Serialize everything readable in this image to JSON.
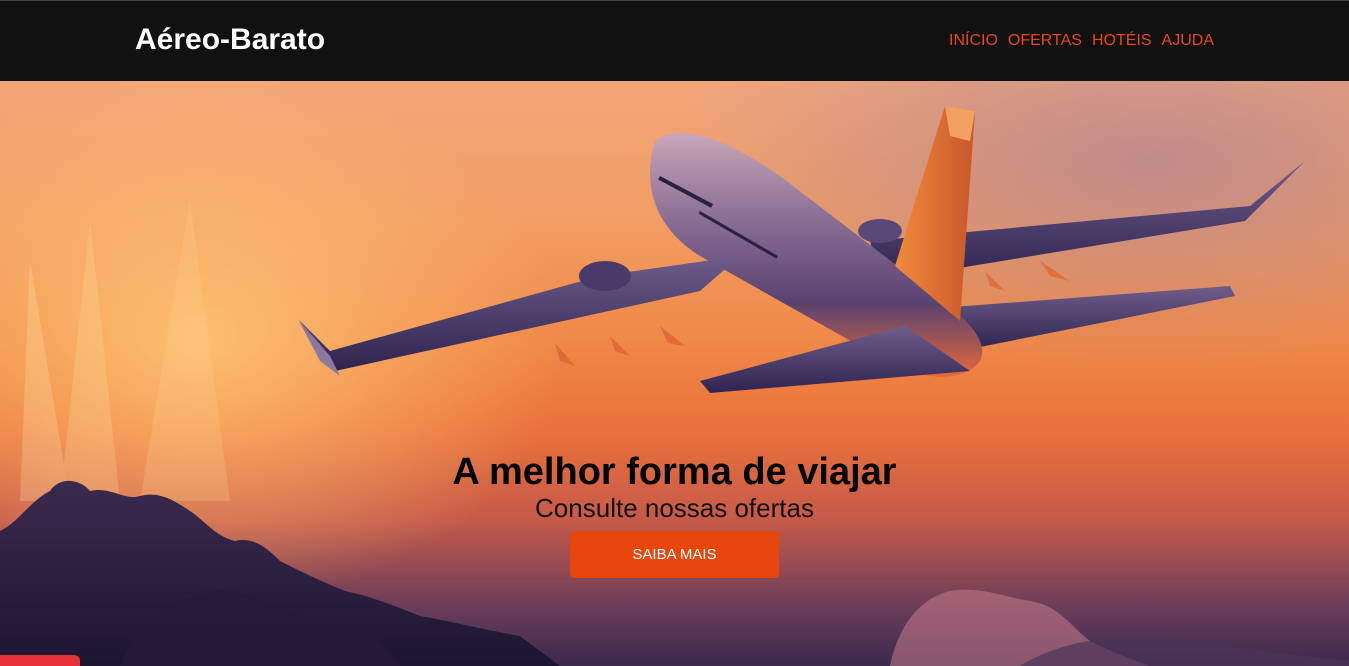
{
  "navbar": {
    "brand": "Aéreo-Barato",
    "links": [
      "INÍCIO",
      "OFERTAS",
      "HOTÉIS",
      "AJUDA"
    ]
  },
  "hero": {
    "headline": "A melhor forma de viajar",
    "subheadline": "Consulte nossas ofertas",
    "cta_label": "SAIBA MAIS",
    "image": "airplane-sunset-image"
  },
  "colors": {
    "navbar_bg": "#111111",
    "brand_text": "#ffffff",
    "nav_link": "#e8481a",
    "cta_bg": "#e8460c",
    "cta_text": "#ffffff"
  }
}
